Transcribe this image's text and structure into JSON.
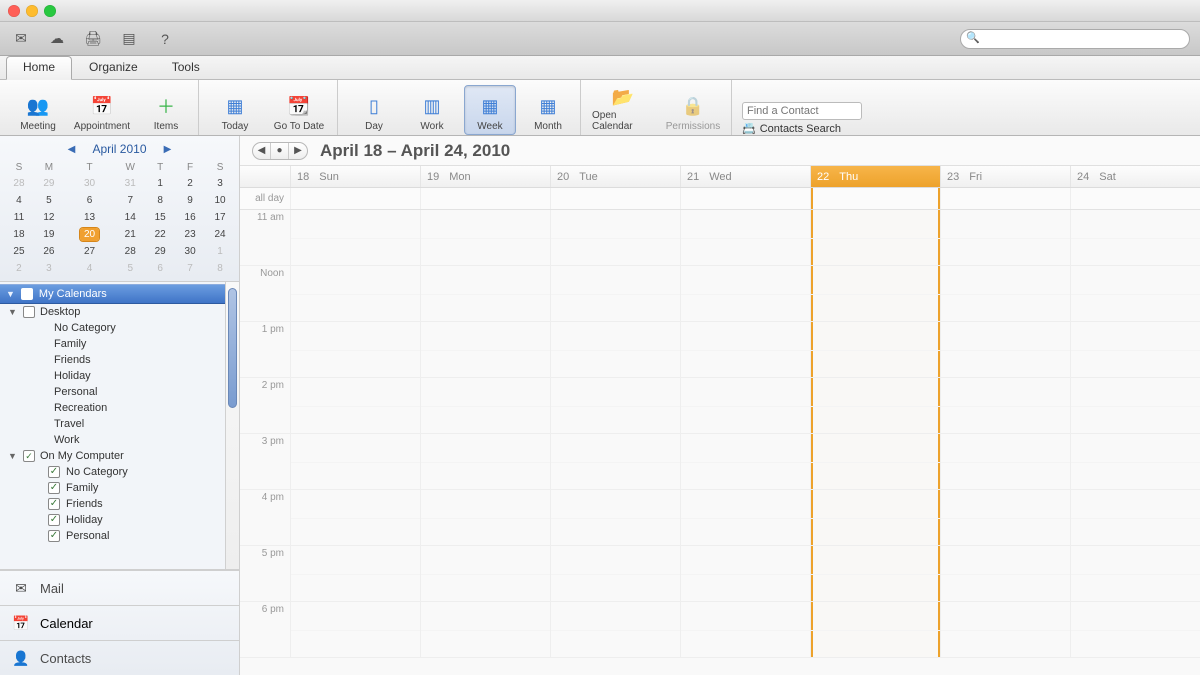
{
  "titlebar": {
    "title": ""
  },
  "search": {
    "placeholder": ""
  },
  "tabs": {
    "home": "Home",
    "organize": "Organize",
    "tools": "Tools"
  },
  "ribbon": {
    "meeting": "Meeting",
    "appointment": "Appointment",
    "items": "Items",
    "today": "Today",
    "gotodate": "Go To Date",
    "day": "Day",
    "work": "Work",
    "week": "Week",
    "month": "Month",
    "opencal": "Open Calendar",
    "permissions": "Permissions",
    "findcontact_placeholder": "Find a Contact",
    "contacts_search": "Contacts Search"
  },
  "minical": {
    "title": "April 2010",
    "dow": [
      "S",
      "M",
      "T",
      "W",
      "T",
      "F",
      "S"
    ],
    "weeks": [
      [
        {
          "n": 28,
          "dim": true
        },
        {
          "n": 29,
          "dim": true
        },
        {
          "n": 30,
          "dim": true
        },
        {
          "n": 31,
          "dim": true
        },
        {
          "n": 1
        },
        {
          "n": 2
        },
        {
          "n": 3
        }
      ],
      [
        {
          "n": 4
        },
        {
          "n": 5
        },
        {
          "n": 6
        },
        {
          "n": 7
        },
        {
          "n": 8
        },
        {
          "n": 9
        },
        {
          "n": 10
        }
      ],
      [
        {
          "n": 11
        },
        {
          "n": 12
        },
        {
          "n": 13
        },
        {
          "n": 14
        },
        {
          "n": 15
        },
        {
          "n": 16
        },
        {
          "n": 17
        }
      ],
      [
        {
          "n": 18
        },
        {
          "n": 19
        },
        {
          "n": 20,
          "today": true
        },
        {
          "n": 21
        },
        {
          "n": 22
        },
        {
          "n": 23
        },
        {
          "n": 24
        }
      ],
      [
        {
          "n": 25
        },
        {
          "n": 26
        },
        {
          "n": 27
        },
        {
          "n": 28
        },
        {
          "n": 29
        },
        {
          "n": 30
        },
        {
          "n": 1,
          "dim": true
        }
      ],
      [
        {
          "n": 2,
          "dim": true
        },
        {
          "n": 3,
          "dim": true
        },
        {
          "n": 4,
          "dim": true
        },
        {
          "n": 5,
          "dim": true
        },
        {
          "n": 6,
          "dim": true
        },
        {
          "n": 7,
          "dim": true
        },
        {
          "n": 8,
          "dim": true
        }
      ]
    ]
  },
  "tree": {
    "header": "My Calendars",
    "desktop": {
      "label": "Desktop",
      "items": [
        "No Category",
        "Family",
        "Friends",
        "Holiday",
        "Personal",
        "Recreation",
        "Travel",
        "Work"
      ]
    },
    "computer": {
      "label": "On My Computer",
      "items": [
        "No Category",
        "Family",
        "Friends",
        "Holiday",
        "Personal"
      ]
    }
  },
  "nav": {
    "mail": "Mail",
    "calendar": "Calendar",
    "contacts": "Contacts"
  },
  "range": {
    "title": "April 18 – April 24, 2010"
  },
  "days": [
    {
      "num": "18",
      "name": "Sun"
    },
    {
      "num": "19",
      "name": "Mon"
    },
    {
      "num": "20",
      "name": "Tue"
    },
    {
      "num": "21",
      "name": "Wed"
    },
    {
      "num": "22",
      "name": "Thu",
      "today": true
    },
    {
      "num": "23",
      "name": "Fri"
    },
    {
      "num": "24",
      "name": "Sat"
    }
  ],
  "allday_label": "all day",
  "hours": [
    "11 am",
    "Noon",
    "1 pm",
    "2 pm",
    "3 pm",
    "4 pm",
    "5 pm",
    "6 pm"
  ],
  "colors": {
    "accent": "#eda22b",
    "tabactive": "#3f74c7"
  }
}
